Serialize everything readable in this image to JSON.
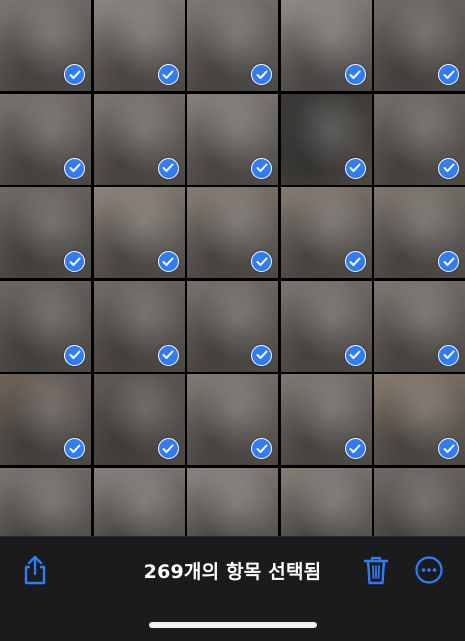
{
  "toolbar": {
    "title": "269개의 항목 선택됨",
    "share_icon": "share-icon",
    "trash_icon": "trash-icon",
    "more_icon": "more-icon",
    "accent_color": "#2f7cf6"
  },
  "grid": {
    "columns": 5,
    "selected_icon": "checkmark-circle-icon",
    "photos": [
      {
        "tone": "#7a7570",
        "selected": true
      },
      {
        "tone": "#8a8580",
        "selected": true
      },
      {
        "tone": "#7d7873",
        "selected": true
      },
      {
        "tone": "#8e8a86",
        "selected": true
      },
      {
        "tone": "#6e6a66",
        "selected": true
      },
      {
        "tone": "#77726c",
        "selected": true
      },
      {
        "tone": "#7b7671",
        "selected": true
      },
      {
        "tone": "#85807a",
        "selected": true
      },
      {
        "tone": "#3a3836",
        "selected": true
      },
      {
        "tone": "#716c68",
        "selected": true
      },
      {
        "tone": "#6d6964",
        "selected": true
      },
      {
        "tone": "#8c847a",
        "selected": true
      },
      {
        "tone": "#857d74",
        "selected": true
      },
      {
        "tone": "#837b72",
        "selected": true
      },
      {
        "tone": "#7e776f",
        "selected": true
      },
      {
        "tone": "#6a6560",
        "selected": true
      },
      {
        "tone": "#6f6a64",
        "selected": true
      },
      {
        "tone": "#75706a",
        "selected": true
      },
      {
        "tone": "#79746e",
        "selected": true
      },
      {
        "tone": "#7c766f",
        "selected": true
      },
      {
        "tone": "#6c625a",
        "selected": true
      },
      {
        "tone": "#5e5853",
        "selected": true
      },
      {
        "tone": "#807a73",
        "selected": true
      },
      {
        "tone": "#7f7871",
        "selected": true
      },
      {
        "tone": "#85796d",
        "selected": true
      },
      {
        "tone": "#7a746e",
        "selected": false
      },
      {
        "tone": "#86807a",
        "selected": false
      },
      {
        "tone": "#8a847e",
        "selected": false
      },
      {
        "tone": "#847d76",
        "selected": false
      },
      {
        "tone": "#6e6862",
        "selected": false
      }
    ]
  }
}
